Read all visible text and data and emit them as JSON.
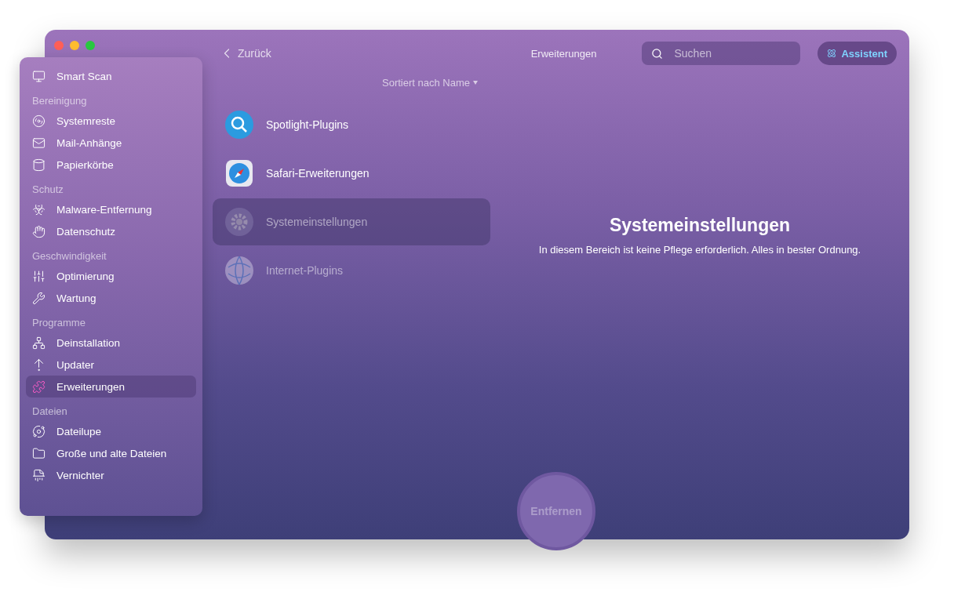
{
  "window": {
    "title": "Erweiterungen"
  },
  "toolbar": {
    "back": "Zurück",
    "search": {
      "placeholder": "Suchen"
    },
    "assistant": "Assistent"
  },
  "sidebar": {
    "groups": [
      {
        "items": [
          {
            "label": "Smart Scan",
            "selected": false
          }
        ]
      },
      {
        "heading": "Bereinigung",
        "items": [
          {
            "label": "Systemreste",
            "selected": false
          },
          {
            "label": "Mail-Anhänge",
            "selected": false
          },
          {
            "label": "Papierkörbe",
            "selected": false
          }
        ]
      },
      {
        "heading": "Schutz",
        "items": [
          {
            "label": "Malware-Entfernung",
            "selected": false
          },
          {
            "label": "Datenschutz",
            "selected": false
          }
        ]
      },
      {
        "heading": "Geschwindigkeit",
        "items": [
          {
            "label": "Optimierung",
            "selected": false
          },
          {
            "label": "Wartung",
            "selected": false
          }
        ]
      },
      {
        "heading": "Programme",
        "items": [
          {
            "label": "Deinstallation",
            "selected": false
          },
          {
            "label": "Updater",
            "selected": false
          },
          {
            "label": "Erweiterungen",
            "selected": true
          }
        ]
      },
      {
        "heading": "Dateien",
        "items": [
          {
            "label": "Dateilupe",
            "selected": false
          },
          {
            "label": "Große und alte Dateien",
            "selected": false
          },
          {
            "label": "Vernichter",
            "selected": false
          }
        ]
      }
    ]
  },
  "sort": "Sortiert nach Name",
  "extensions": [
    {
      "label": "Spotlight-Plugins",
      "selected": false,
      "disabled": false
    },
    {
      "label": "Safari-Erweiterungen",
      "selected": false,
      "disabled": false
    },
    {
      "label": "Systemeinstellungen",
      "selected": true,
      "disabled": true
    },
    {
      "label": "Internet-Plugins",
      "selected": false,
      "disabled": true
    }
  ],
  "detail": {
    "title": "Systemeinstellungen",
    "message": "In diesem Bereich ist keine Pflege erforderlich. Alles in bester Ordnung."
  },
  "action": {
    "label": "Entfernen",
    "disabled": true
  }
}
